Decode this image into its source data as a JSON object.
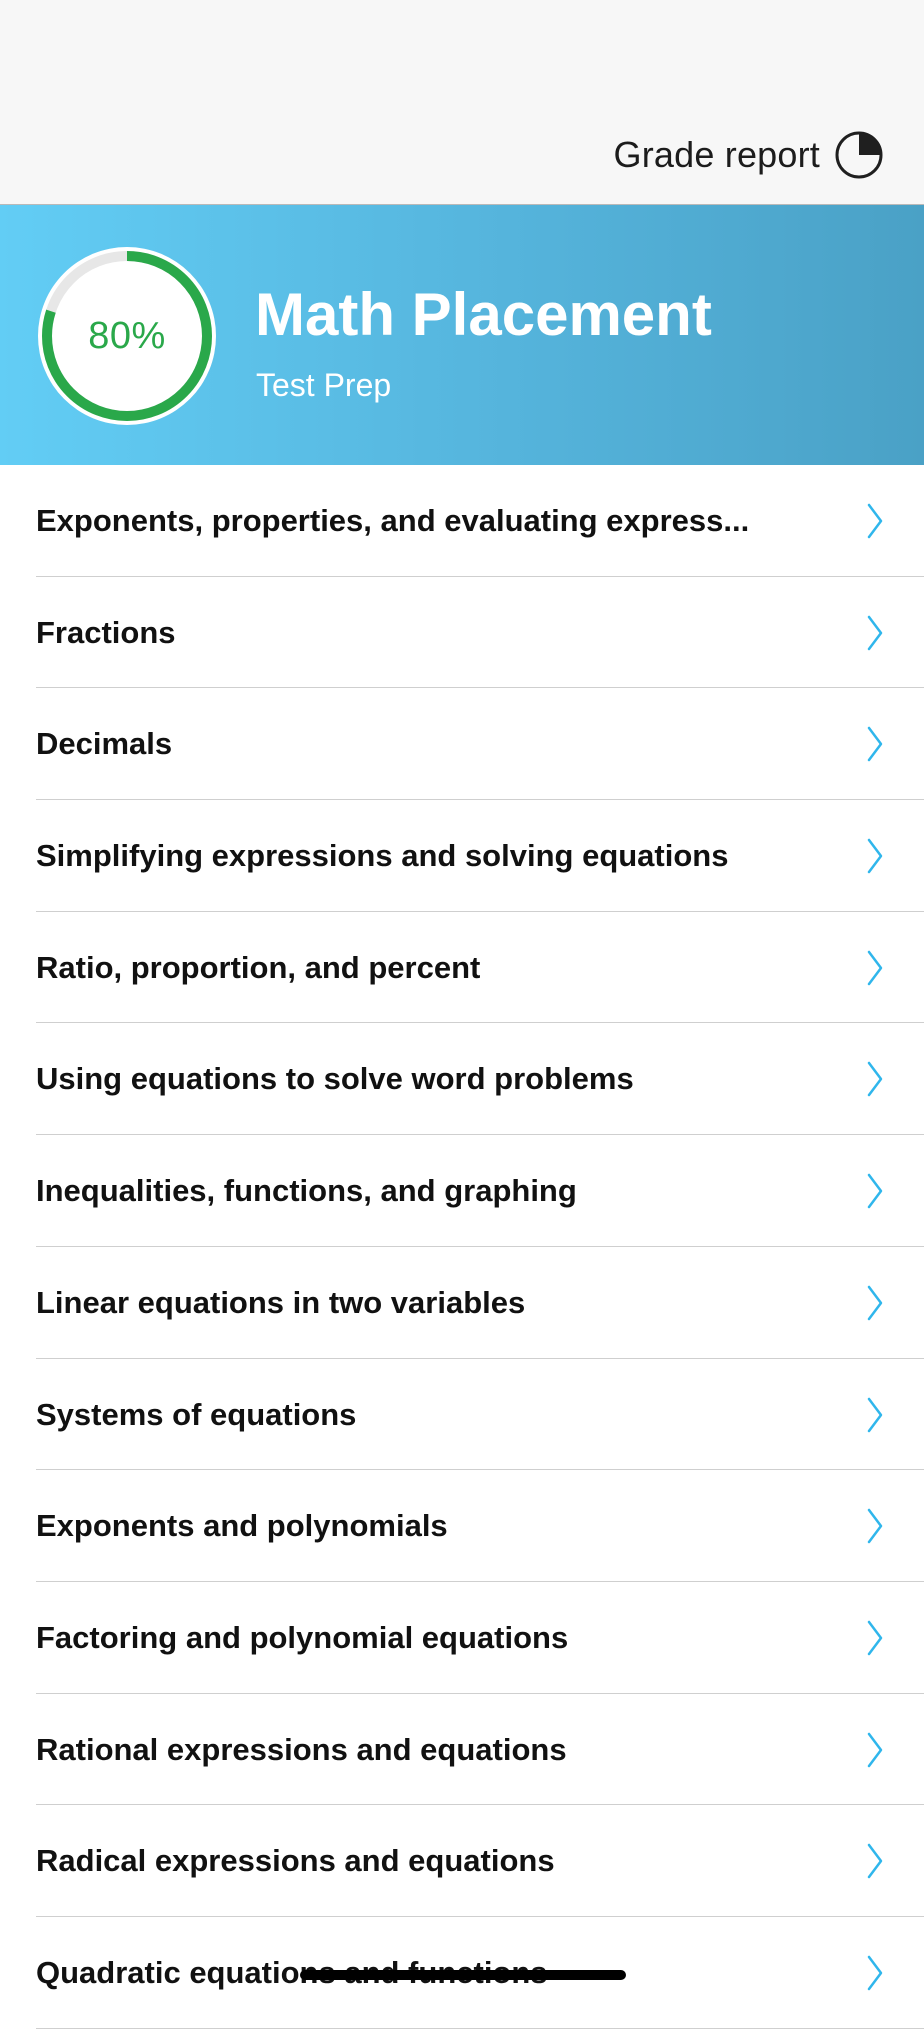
{
  "topbar": {
    "grade_report_label": "Grade report",
    "grade_report_icon": "pie-chart-icon"
  },
  "hero": {
    "progress_label": "80%",
    "progress_value": 0.8,
    "title": "Math Placement",
    "subtitle": "Test Prep"
  },
  "topics": [
    {
      "label": "Exponents, properties, and evaluating express..."
    },
    {
      "label": "Fractions"
    },
    {
      "label": "Decimals"
    },
    {
      "label": "Simplifying expressions and solving equations"
    },
    {
      "label": "Ratio, proportion, and percent"
    },
    {
      "label": "Using equations to solve word problems"
    },
    {
      "label": "Inequalities, functions, and graphing"
    },
    {
      "label": "Linear equations in two variables"
    },
    {
      "label": "Systems of equations"
    },
    {
      "label": "Exponents and polynomials"
    },
    {
      "label": "Factoring and polynomial equations"
    },
    {
      "label": "Rational expressions and equations"
    },
    {
      "label": "Radical expressions and equations"
    },
    {
      "label": "Quadratic equations and functions"
    }
  ],
  "icons": {
    "row_chevron": "chevron-right-icon"
  },
  "colors": {
    "hero_gradient_start": "#62cdf5",
    "hero_gradient_end": "#4aa1c6",
    "progress_green": "#2aa84a",
    "chevron_blue": "#2fb6ec",
    "divider": "#cfcfcf"
  }
}
